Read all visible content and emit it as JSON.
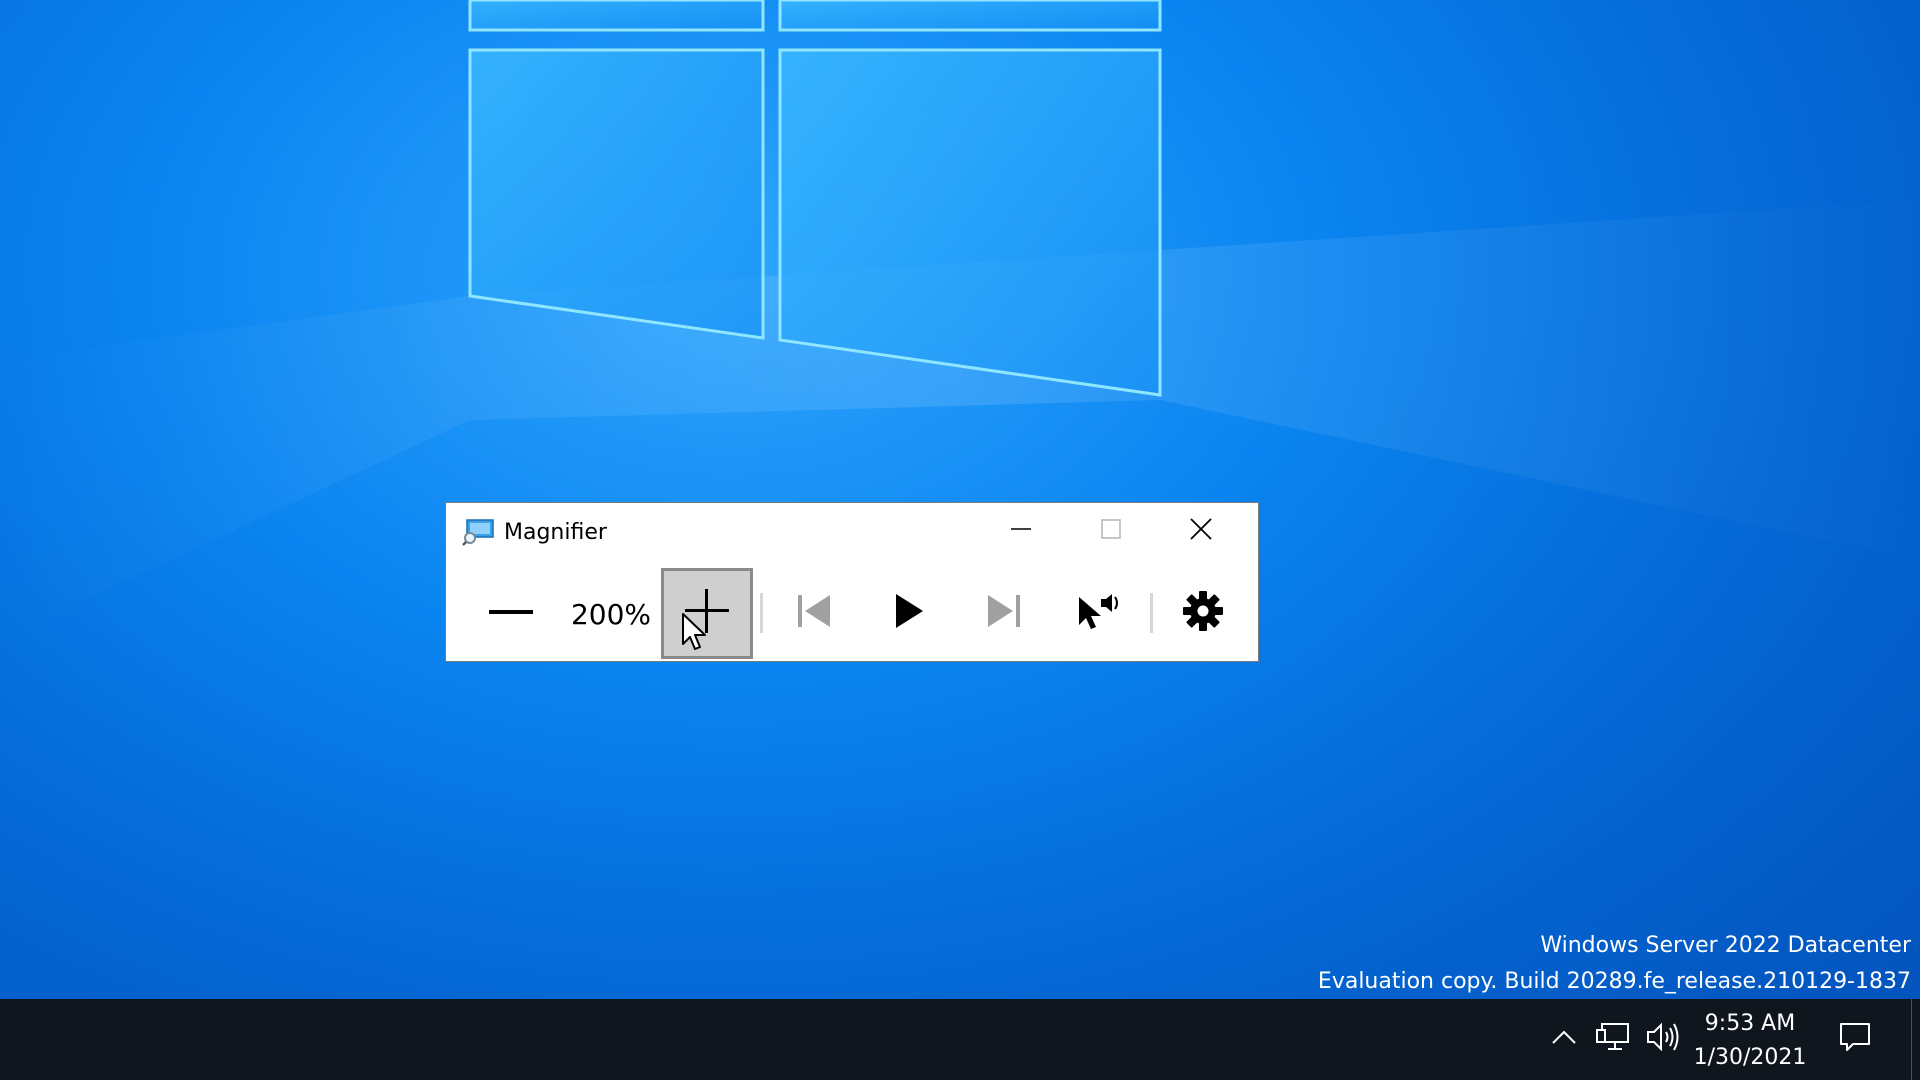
{
  "desktop": {
    "watermark": {
      "line1": "Windows Server 2022 Datacenter",
      "line2": "Evaluation copy. Build 20289.fe_release.210129-1837"
    }
  },
  "magnifier": {
    "title": "Magnifier",
    "icon": "magnifier-app-icon",
    "zoom_level": "200%",
    "caption_buttons": [
      "minimize-icon",
      "maximize-icon",
      "close-icon"
    ],
    "toolbar_icons": [
      "zoom-out-icon",
      "zoom-in-icon",
      "previous-paragraph-icon",
      "play-icon",
      "next-paragraph-icon",
      "read-from-here-icon",
      "settings-gear-icon"
    ]
  },
  "taskbar": {
    "tray_icons": [
      "chevron-up-icon",
      "network-icon",
      "volume-icon",
      "notifications-icon"
    ],
    "clock": {
      "time": "9:53 AM",
      "date": "1/30/2021"
    }
  },
  "colors": {
    "desktop_blue": "#0a84f0",
    "taskbar": "#10161e",
    "window_bg": "#ffffff",
    "pressed_button": "#cfcfcf"
  }
}
